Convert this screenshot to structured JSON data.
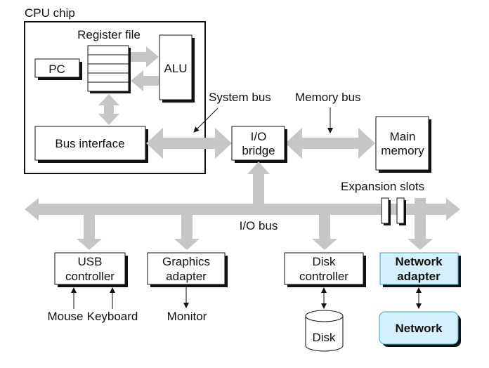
{
  "colors": {
    "bus": "#c6c6c6",
    "highlight": "#d4f0fb",
    "highlight_border": "#3aa6c9"
  },
  "cpu": {
    "title": "CPU chip",
    "register_file": "Register file",
    "pc": "PC",
    "alu": "ALU",
    "bus_interface": "Bus interface"
  },
  "buses": {
    "system_bus": "System bus",
    "memory_bus": "Memory bus",
    "io_bus": "I/O bus",
    "expansion_slots": "Expansion slots"
  },
  "io_bridge": {
    "line1": "I/O",
    "line2": "bridge"
  },
  "main_memory": {
    "line1": "Main",
    "line2": "memory"
  },
  "devices": {
    "usb": {
      "line1": "USB",
      "line2": "controller"
    },
    "graphics": {
      "line1": "Graphics",
      "line2": "adapter"
    },
    "disk_controller": {
      "line1": "Disk",
      "line2": "controller"
    },
    "network_adapter": {
      "line1": "Network",
      "line2": "adapter"
    }
  },
  "peripherals": {
    "mouse": "Mouse",
    "keyboard": "Keyboard",
    "monitor": "Monitor",
    "disk": "Disk",
    "network": "Network"
  }
}
